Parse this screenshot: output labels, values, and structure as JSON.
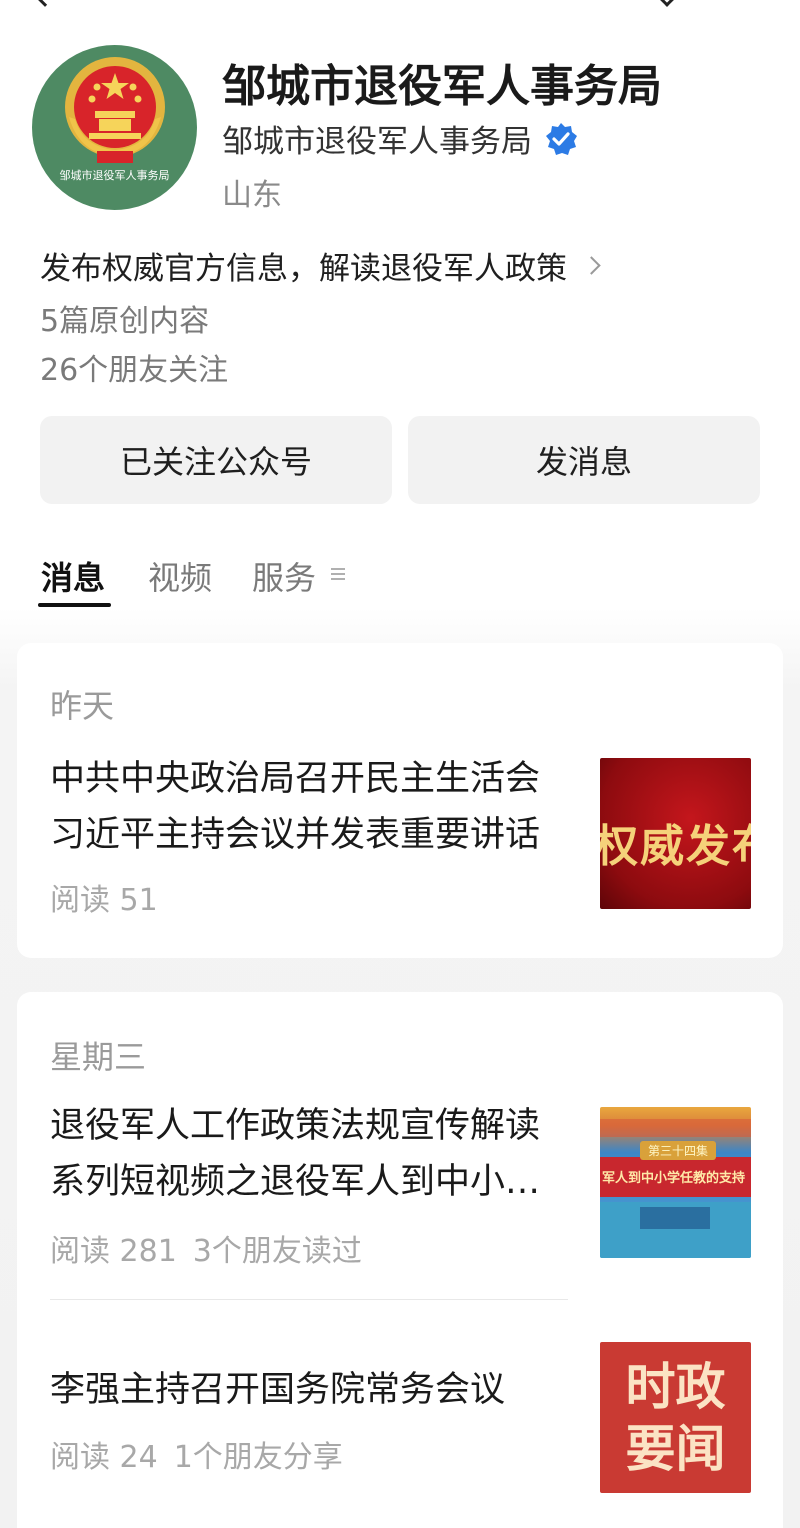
{
  "header": {
    "account_name": "邹城市退役军人事务局",
    "account_subname": "邹城市退役军人事务局",
    "region": "山东",
    "avatar_caption": "邹城市退役军人事务局",
    "intro": "发布权威官方信息，解读退役军人政策",
    "original_count": "5篇原创内容",
    "friends_following": "26个朋友关注"
  },
  "actions": {
    "follow_label": "已关注公众号",
    "message_label": "发消息"
  },
  "tabs": [
    {
      "label": "消息",
      "active": true
    },
    {
      "label": "视频",
      "active": false
    },
    {
      "label": "服务",
      "active": false
    }
  ],
  "feed": [
    {
      "date": "昨天",
      "articles": [
        {
          "title": "中共中央政治局召开民主生活会 习近平主持会议并发表重要讲话",
          "reads": "阅读 51",
          "extra": "",
          "thumb_text": "权威发布"
        }
      ]
    },
    {
      "date": "星期三",
      "articles": [
        {
          "title": "退役军人工作政策法规宣传解读系列短视频之退役军人到中小学任教的支持政策",
          "reads": "阅读 281",
          "extra": "3个朋友读过",
          "thumb_badge": "第三十四集",
          "thumb_text": "军人到中小学任教的支持"
        },
        {
          "title": "李强主持召开国务院常务会议",
          "reads": "阅读 24",
          "extra": "1个朋友分享",
          "thumb_text_line1": "时政",
          "thumb_text_line2": "要闻"
        }
      ]
    }
  ],
  "colors": {
    "verified": "#2c7be5",
    "avatar_bg": "#4e8a63",
    "tab_active": "#111111",
    "meta_text": "#a8a8a8"
  },
  "icons": [
    "back-icon",
    "more-icon",
    "verified-icon",
    "chevron-right-icon",
    "menu-icon",
    "national-emblem-icon"
  ]
}
